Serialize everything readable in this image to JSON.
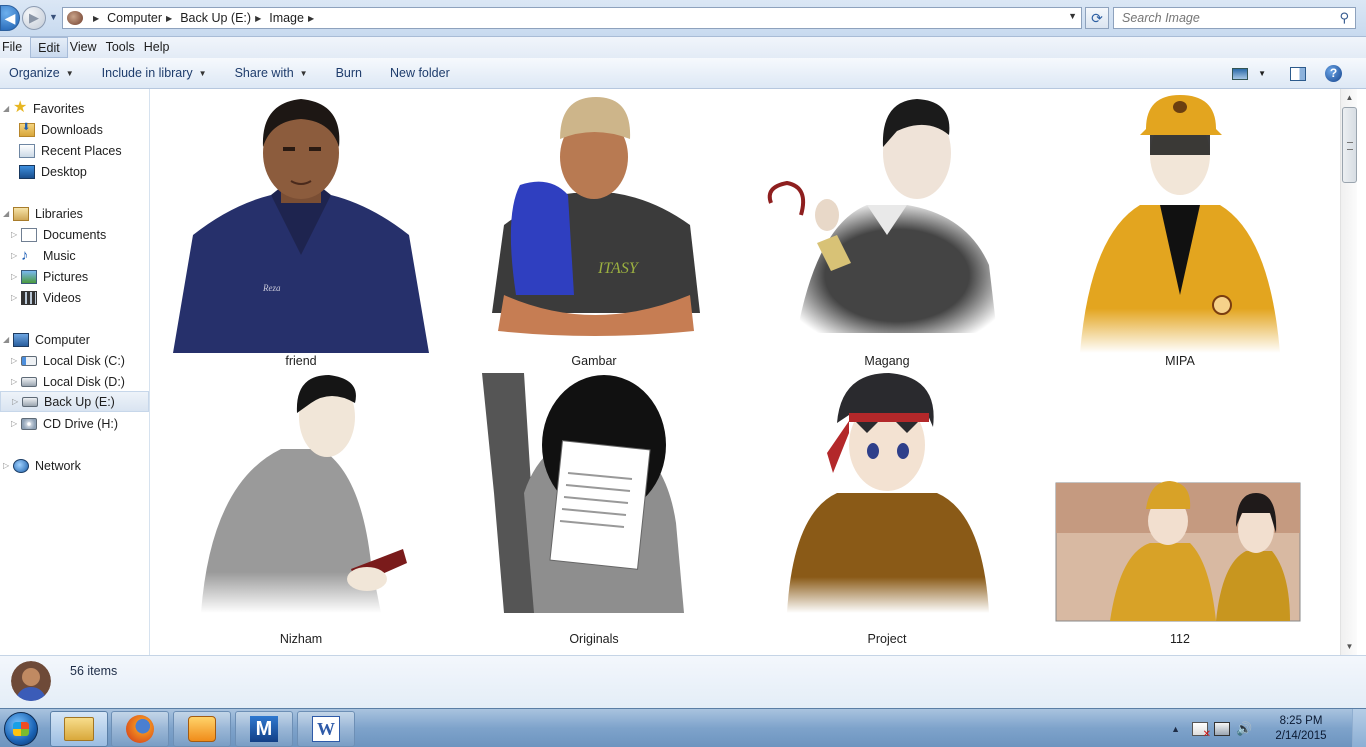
{
  "address": {
    "crumbs": [
      "Computer",
      "Back Up (E:)",
      "Image"
    ]
  },
  "search": {
    "placeholder": "Search Image"
  },
  "menu": [
    "File",
    "Edit",
    "View",
    "Tools",
    "Help"
  ],
  "menu_active": "Edit",
  "toolbar": {
    "organize": "Organize",
    "include_in_library": "Include in library",
    "share_with": "Share with",
    "burn": "Burn",
    "new_folder": "New folder",
    "help": "?"
  },
  "navigation": {
    "favorites": {
      "label": "Favorites",
      "items": [
        "Downloads",
        "Recent Places",
        "Desktop"
      ]
    },
    "libraries": {
      "label": "Libraries",
      "items": [
        "Documents",
        "Music",
        "Pictures",
        "Videos"
      ]
    },
    "computer": {
      "label": "Computer",
      "items": [
        "Local Disk (C:)",
        "Local Disk (D:)",
        "Back Up (E:)",
        "CD Drive (H:)"
      ],
      "selected": "Back Up (E:)"
    },
    "network": {
      "label": "Network"
    }
  },
  "files": [
    {
      "name": "friend",
      "icon": "portrait-blue-shirt"
    },
    {
      "name": "Gambar",
      "icon": "portrait-beanie"
    },
    {
      "name": "Magang",
      "icon": "portrait-medal"
    },
    {
      "name": "MIPA",
      "icon": "portrait-yellow-jacket"
    },
    {
      "name": "Nizham",
      "icon": "portrait-grey-shirt"
    },
    {
      "name": "Originals",
      "icon": "portrait-paper"
    },
    {
      "name": "Project",
      "icon": "portrait-anime-armor"
    },
    {
      "name": "112",
      "icon": "portrait-anime-pair"
    }
  ],
  "status": {
    "item_count": "56 items"
  },
  "taskbar": {
    "apps": [
      "windows-explorer",
      "firefox",
      "media-player",
      "m-app",
      "word"
    ],
    "clock_time": "8:25 PM",
    "clock_date": "2/14/2015"
  },
  "colors": {
    "chrome_blue": "#dbe7f5",
    "taskbar_blue": "#7ea3cb",
    "selection": "#d9e4f1"
  }
}
